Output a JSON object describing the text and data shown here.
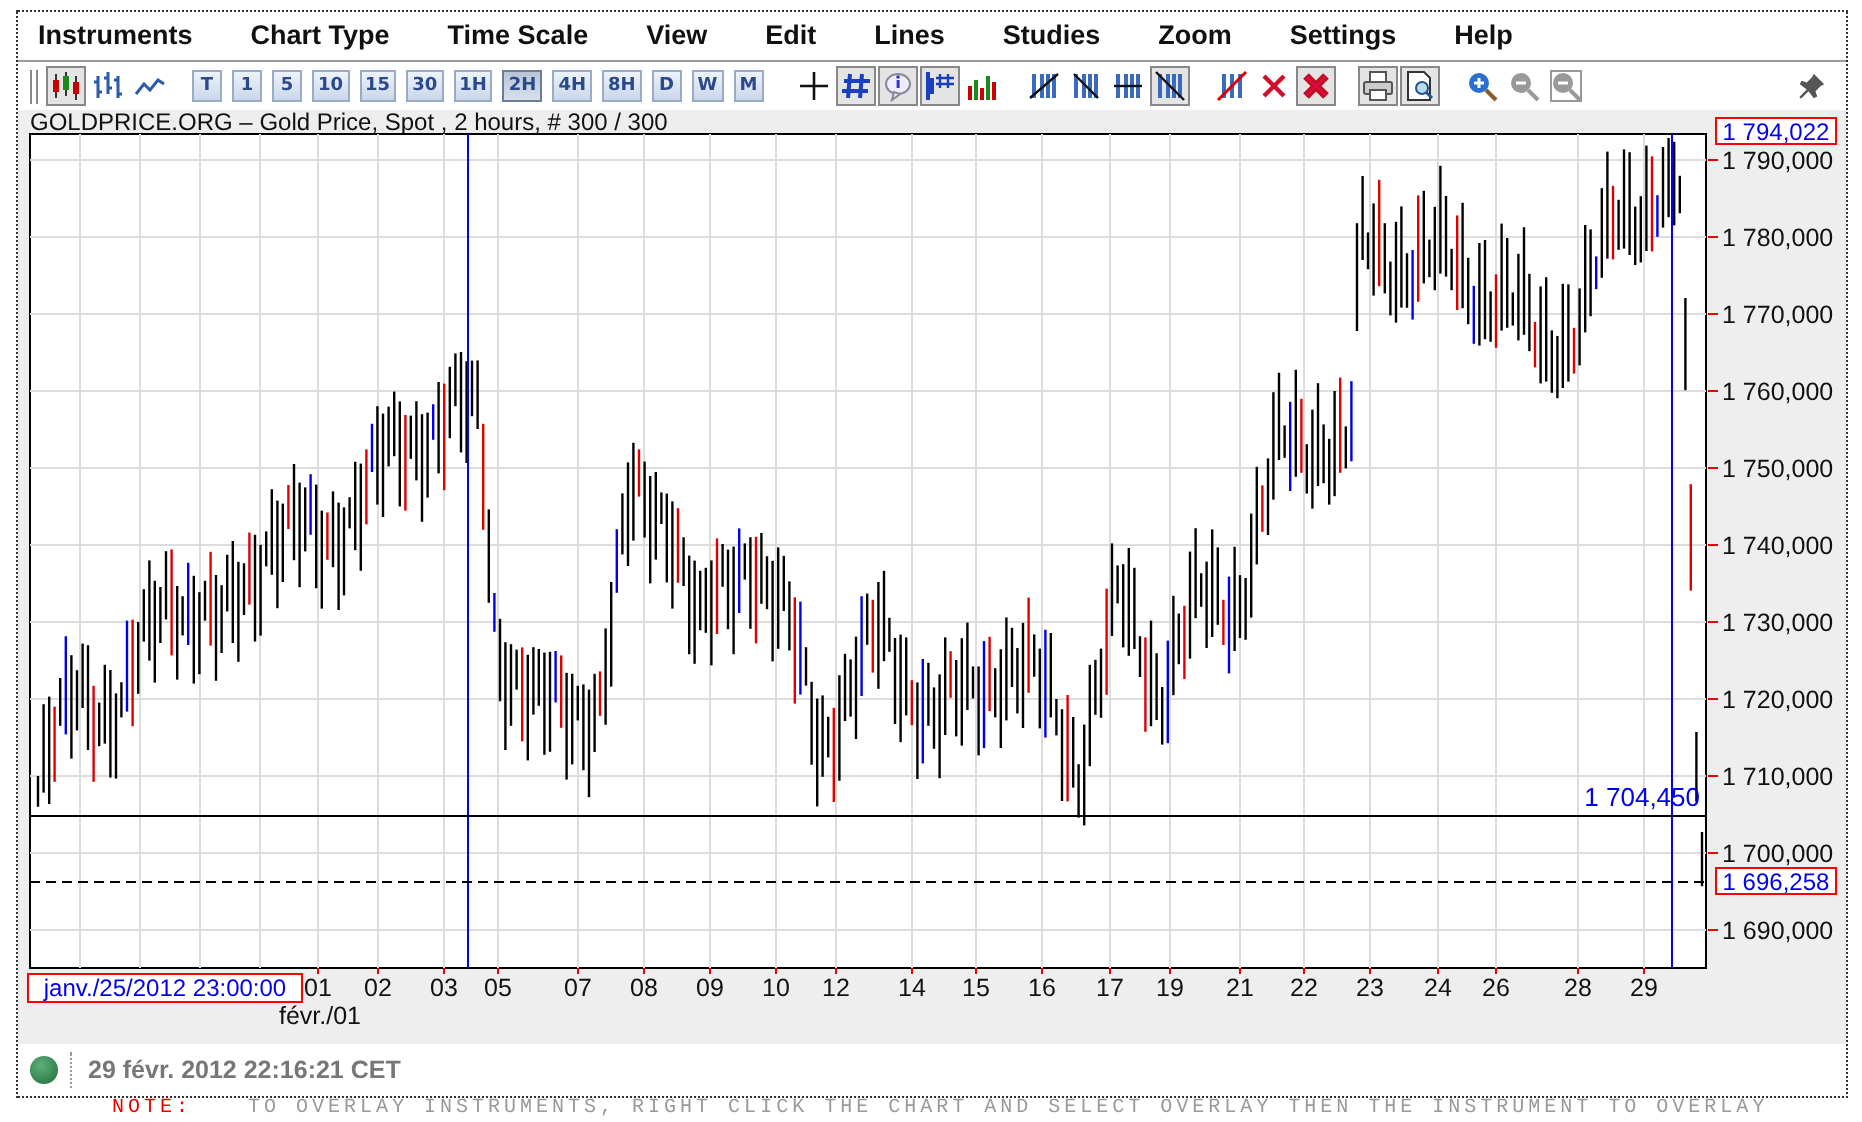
{
  "menu": [
    "Instruments",
    "Chart Type",
    "Time Scale",
    "View",
    "Edit",
    "Lines",
    "Studies",
    "Zoom",
    "Settings",
    "Help"
  ],
  "toolbar": {
    "chart_types": [
      {
        "selected": true
      },
      {
        "selected": false
      },
      {
        "selected": false
      }
    ],
    "time_scales": [
      {
        "label": "T",
        "selected": false
      },
      {
        "label": "1",
        "selected": false
      },
      {
        "label": "5",
        "selected": false
      },
      {
        "label": "10",
        "selected": false
      },
      {
        "label": "15",
        "selected": false
      },
      {
        "label": "30",
        "selected": false
      },
      {
        "label": "1H",
        "selected": false
      },
      {
        "label": "2H",
        "selected": true
      },
      {
        "label": "4H",
        "selected": false
      },
      {
        "label": "8H",
        "selected": false
      },
      {
        "label": "D",
        "selected": false
      },
      {
        "label": "W",
        "selected": false
      },
      {
        "label": "M",
        "selected": false
      }
    ],
    "chart_tools": [
      {
        "selected": false
      },
      {
        "selected": true
      },
      {
        "selected": true
      },
      {
        "selected": true
      },
      {
        "selected": false
      }
    ],
    "line_tools": [
      {
        "selected": false
      },
      {
        "selected": false
      },
      {
        "selected": false
      },
      {
        "selected": true
      }
    ],
    "delete_tools": [
      {
        "selected": false
      },
      {
        "selected": false
      },
      {
        "selected": true
      }
    ],
    "print_tools": [
      {
        "selected": true
      },
      {
        "selected": true
      }
    ],
    "zoom_tools": [
      {
        "disabled": false
      },
      {
        "disabled": true
      },
      {
        "disabled": true
      }
    ]
  },
  "chart": {
    "title": "GOLDPRICE.ORG – Gold Price, Spot , 2 hours, # 300 / 300",
    "y_labels": [
      "1 790,000",
      "1 780,000",
      "1 770,000",
      "1 760,000",
      "1 750,000",
      "1 740,000",
      "1 730,000",
      "1 720,000",
      "1 710,000",
      "1 700,000",
      "1 690,000"
    ],
    "x_labels": [
      "01",
      "02",
      "03",
      "05",
      "07",
      "08",
      "09",
      "10",
      "12",
      "14",
      "15",
      "16",
      "17",
      "19",
      "21",
      "22",
      "23",
      "24",
      "26",
      "28",
      "29"
    ],
    "month_label": "févr./01",
    "cursor_date": "janv./25/2012 23:00:00",
    "high_marker": "1 794,022",
    "last_marker": "1 696,258",
    "line_label": "1 704,450"
  },
  "status_bar": {
    "connected": true,
    "time": "29 févr. 2012 22:16:21 CET"
  },
  "note": {
    "label": "NOTE:",
    "text": "TO OVERLAY INSTRUMENTS, RIGHT CLICK THE CHART AND SELECT OVERLAY THEN THE INSTRUMENT TO OVERLAY"
  }
}
